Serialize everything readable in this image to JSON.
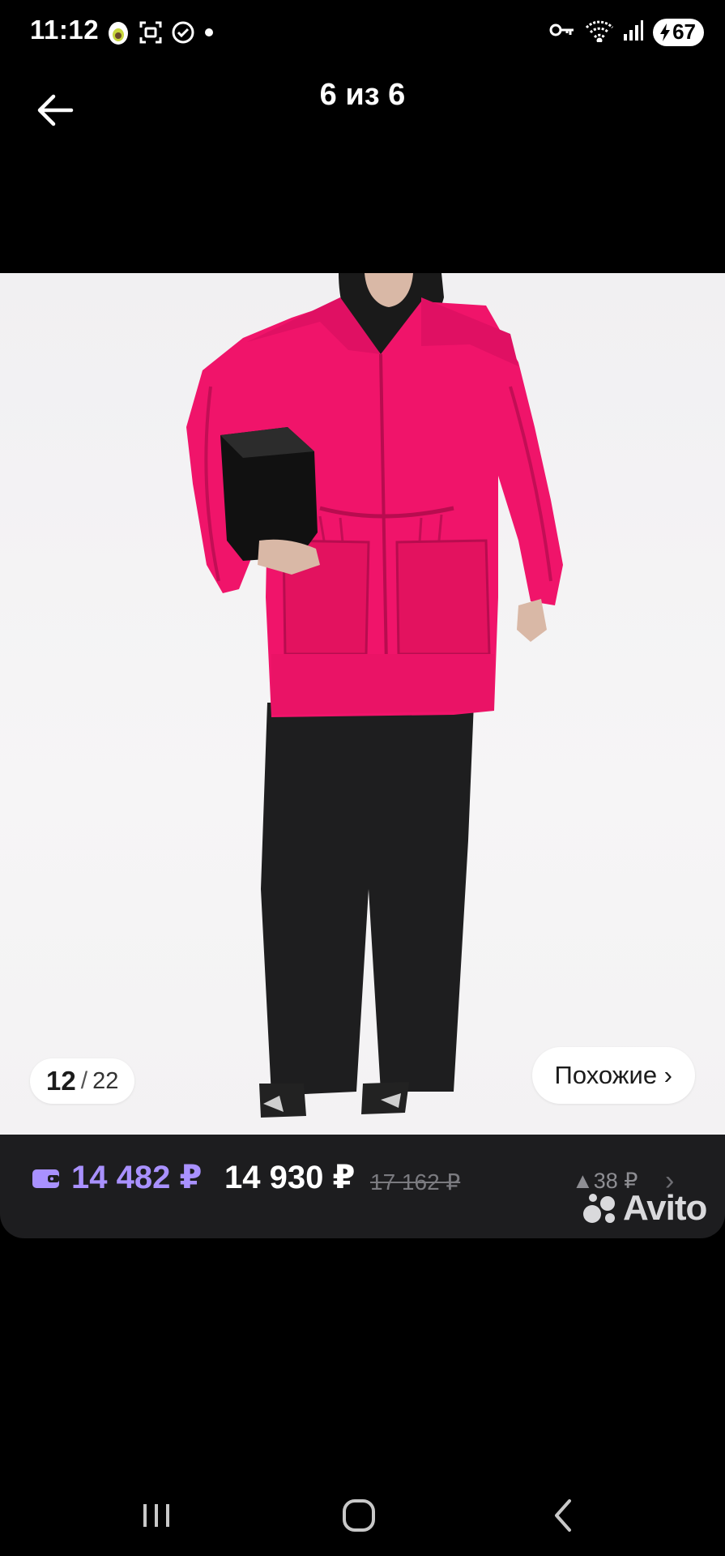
{
  "status_bar": {
    "time": "11:12",
    "battery": "67"
  },
  "header": {
    "title": "6 из 6"
  },
  "photo": {
    "counter_current": "12",
    "counter_separator": "/",
    "counter_total": "22",
    "similar_label": "Похожие ›"
  },
  "price_bar": {
    "wallet_price": "14 482 ₽",
    "price": "14 930 ₽",
    "old_price": "17 162 ₽",
    "delta": "▲38 ₽",
    "chevron": "›",
    "logo_text": "Avito",
    "wallet_color": "#a991ff"
  },
  "colors": {
    "jacket": "#f0146a",
    "background": "#000000",
    "bar": "#1d1d1f"
  }
}
